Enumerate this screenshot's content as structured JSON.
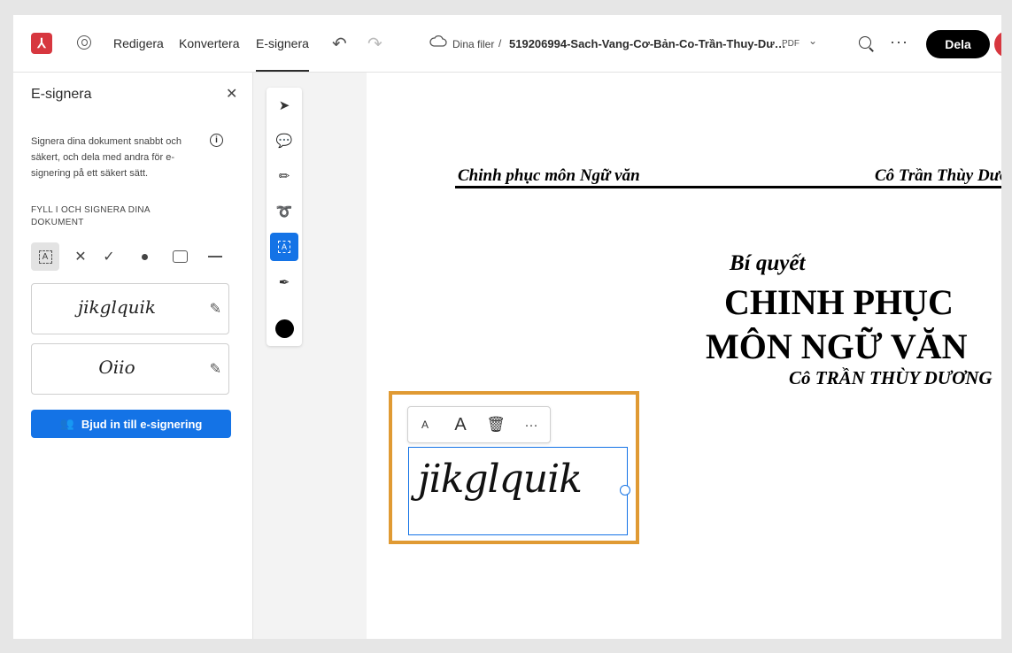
{
  "topbar": {
    "nav": [
      "Redigera",
      "Konvertera",
      "E-signera"
    ],
    "breadcrumb_root": "Dina filer",
    "breadcrumb_sep": "/",
    "filename": "519206994-Sach-Vang-Cơ-Bản-Co-Trần-Thuy-Dư…",
    "file_type": "PDF",
    "share_label": "Dela"
  },
  "panel": {
    "title": "E-signera",
    "description": "Signera dina dokument snabbt och säkert, och dela med andra för e-signering på ett säkert sätt.",
    "section_label": "FYLL I OCH SIGNERA DINA DOKUMENT",
    "signature_1": "jikglquik",
    "signature_2": "Oiio",
    "invite_label": "Bjud in till e-signering"
  },
  "document": {
    "header_left": "Chinh phục môn Ngữ văn",
    "header_right": "Cô Trần Thùy Dương",
    "line1": "Bí quyết",
    "line2": "CHINH PHỤC",
    "line3": "MÔN NGỮ VĂN",
    "line4": "Cô TRẦN THÙY DƯƠNG"
  },
  "signature_field": {
    "text": "jikglquik",
    "toolbar": {
      "small_a": "A",
      "large_a": "A",
      "more": "···"
    }
  },
  "colors": {
    "accent": "#1473e6",
    "highlight": "#e09a33",
    "brand": "#d7373f"
  }
}
